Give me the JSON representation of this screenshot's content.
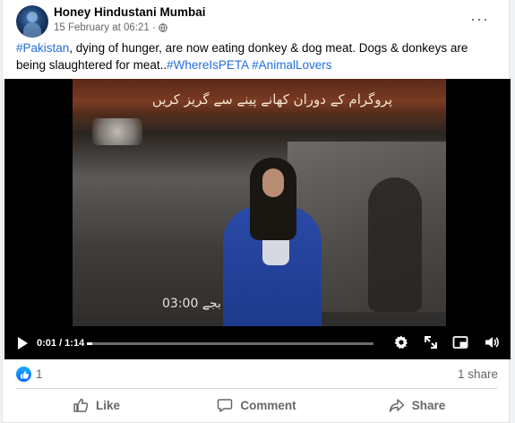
{
  "post": {
    "author": "Honey Hindustani Mumbai",
    "timestamp": "15 February at 06:21 ·",
    "text_tag1": "#Pakistan",
    "text_body": ", dying of hunger, are now eating donkey & dog meat. Dogs & donkeys are being slaughtered for meat..",
    "text_tag2": "#WhereIsPETA",
    "text_tag3": "#AnimalLovers",
    "icons": {
      "privacy": "globe-icon",
      "more": "more-options-icon"
    }
  },
  "video": {
    "overlay_urdu_top": "پروگرام کے دوران کھانے پینے سے گریز کریں",
    "overlay_urdu_bottom": "03:00 بجے",
    "time_display": "0:01 / 1:14",
    "progress": 0.013,
    "icons": [
      "play-icon",
      "settings-gear-icon",
      "fullscreen-icon",
      "picture-in-picture-icon",
      "volume-icon"
    ]
  },
  "engagement": {
    "reaction_count": "1",
    "share_count": "1 share"
  },
  "actions": {
    "like": "Like",
    "comment": "Comment",
    "share": "Share"
  },
  "colors": {
    "link": "#216fdb",
    "like_blue": "#0866ff",
    "secondary_text": "#65676b"
  }
}
